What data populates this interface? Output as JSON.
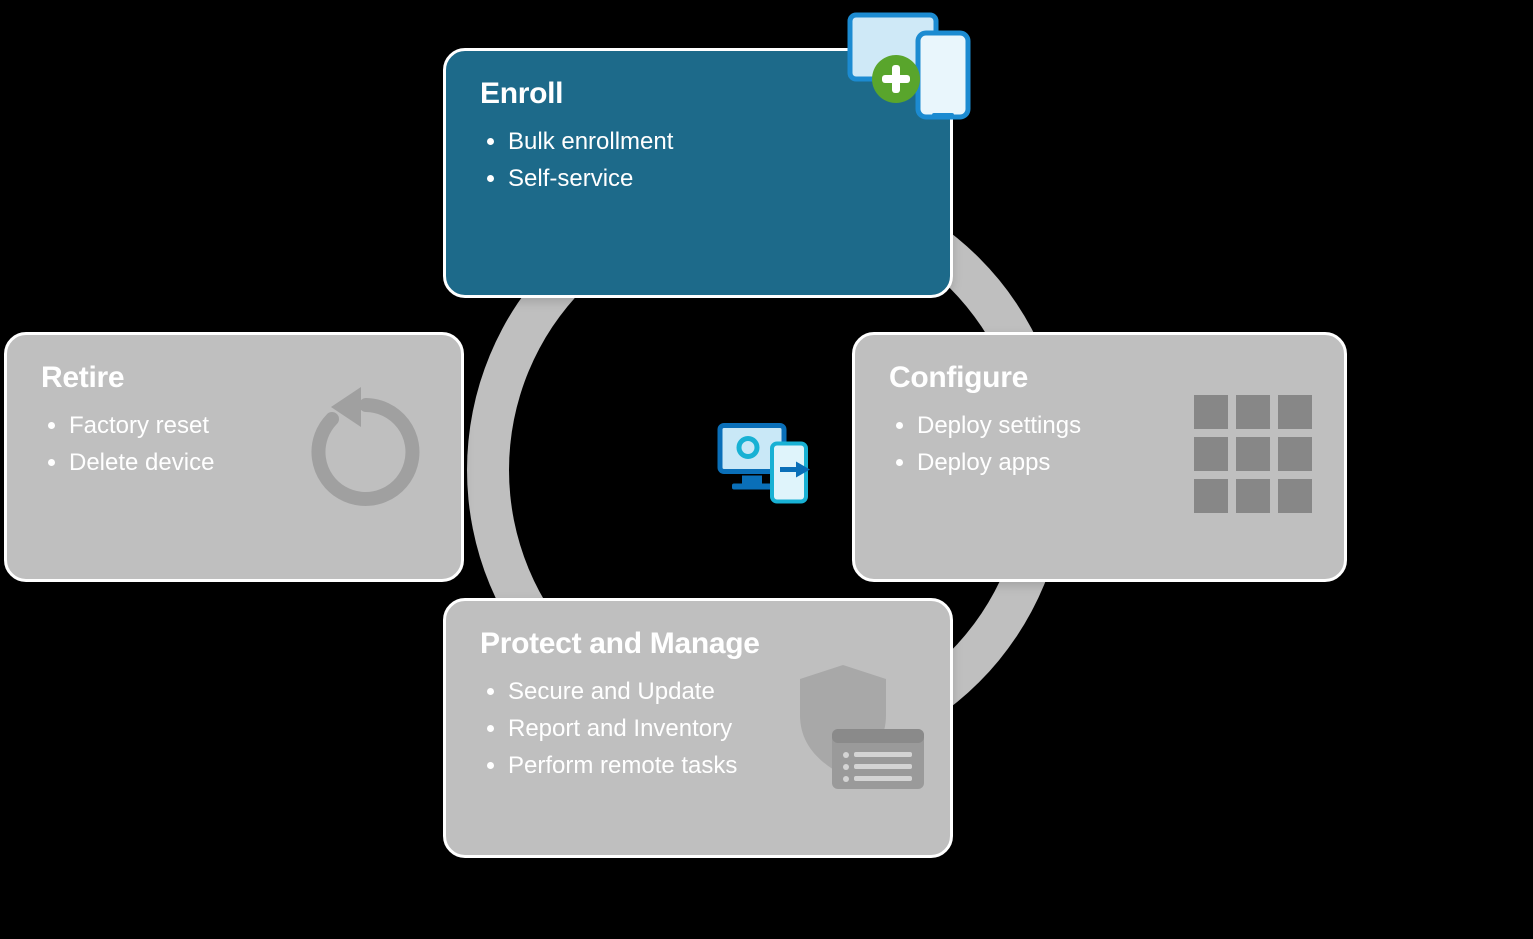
{
  "diagram": {
    "center_icon": "intune-devices-icon",
    "cards": {
      "enroll": {
        "title": "Enroll",
        "items": [
          "Bulk enrollment",
          "Self-service"
        ],
        "active": true,
        "icon": "add-devices-icon"
      },
      "configure": {
        "title": "Configure",
        "items": [
          "Deploy settings",
          "Deploy apps"
        ],
        "active": false,
        "icon": "apps-grid-icon"
      },
      "protect": {
        "title": "Protect and Manage",
        "items": [
          "Secure and Update",
          "Report and Inventory",
          "Perform remote tasks"
        ],
        "active": false,
        "icon": "shield-list-icon"
      },
      "retire": {
        "title": "Retire",
        "items": [
          "Factory reset",
          "Delete device"
        ],
        "active": false,
        "icon": "restart-icon"
      }
    }
  }
}
